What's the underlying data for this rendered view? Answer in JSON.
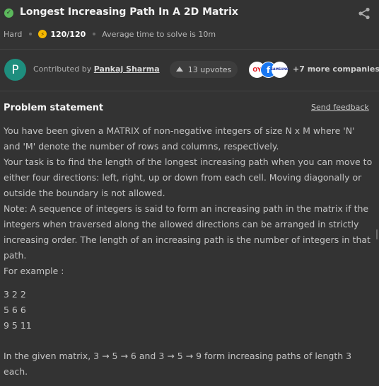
{
  "header": {
    "title": "Longest Increasing Path In A 2D Matrix",
    "difficulty": "Hard",
    "score": "120/120",
    "avg_time": "Average time to solve is 10m"
  },
  "contributor": {
    "avatar_letter": "P",
    "prefix": "Contributed by ",
    "name": "Pankaj Sharma",
    "upvotes": "13 upvotes",
    "company_logos": [
      "OY",
      "f",
      "SAMSUNG"
    ],
    "more_companies": "+7 more companies"
  },
  "problem": {
    "heading": "Problem statement",
    "feedback_label": "Send feedback",
    "paragraphs": [
      "You have been given a MATRIX of non-negative integers of size N x M where 'N' and 'M' denote the number of rows and columns, respectively.",
      "Your task is to find the length of the longest increasing path when you can move to either four directions: left, right, up or down from each cell. Moving diagonally or outside the boundary is not allowed.",
      "Note: A sequence of integers is said to form an increasing path in the matrix if the integers when traversed along the allowed directions can be arranged in strictly increasing order. The length of an increasing path is the number of integers in that path.",
      "For example :"
    ],
    "matrix_rows": [
      "3 2 2",
      "5 6 6",
      "9 5 11"
    ],
    "explanation": "In the given matrix, 3 →  5 →  6 and 3 →  5 →  9 form increasing paths of length 3 each."
  },
  "colors": {
    "background": "#333333",
    "success": "#5cb85c",
    "coin": "#f5b800",
    "avatar": "#1e8e7e"
  },
  "icons": [
    "check-circle-icon",
    "share-icon",
    "coin-icon",
    "upvote-arrow-icon"
  ]
}
